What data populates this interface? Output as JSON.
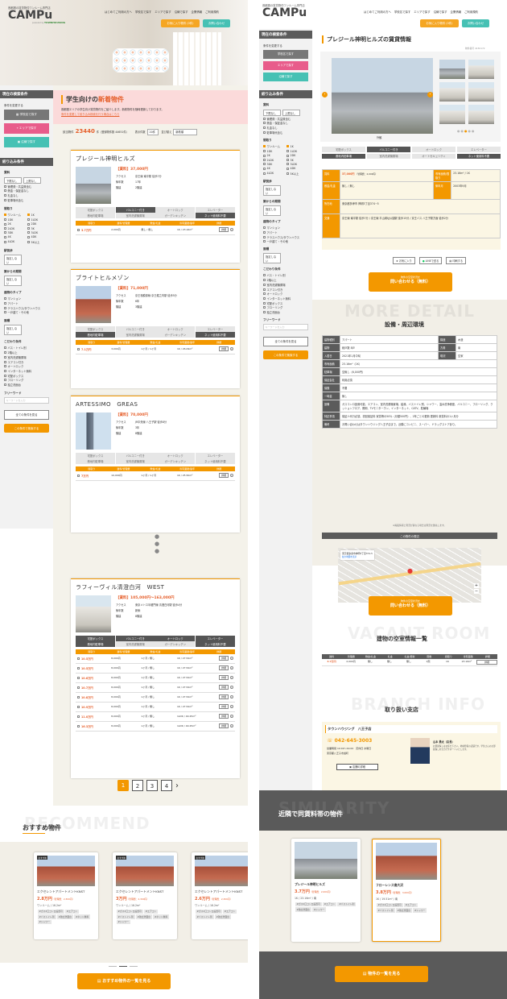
{
  "left": {
    "header": {
      "tagline": "首都圏の賃貸物件ワンルーム専門店",
      "logo": "CAMPu",
      "logo_sub": "powered by",
      "partner": "TOWNHOUSING",
      "nav": [
        "はじめてご利用の方へ",
        "学校名で探す",
        "エリアで探す",
        "沿線で探す",
        "企業情報",
        "ご利用規約"
      ],
      "btn_inquiry": "お気に入り物件 (0件)",
      "btn_contact": "お問い合わせ"
    },
    "sidebar": {
      "current_title": "現在の検索条件",
      "change_label": "条件を変更する",
      "btn_school": "学校名で探す",
      "btn_area": "エリアで探す",
      "btn_line": "沿線で探す",
      "refine_title": "絞り込み条件",
      "rent_label": "賃料",
      "rent_min": "下限なし",
      "rent_max": "上限なし",
      "rent_opts": [
        "管理費・共益費含む",
        "敷金・保証金なし",
        "礼金なし",
        "駐車場代含む"
      ],
      "layout_label": "間取り",
      "layouts": [
        "ワンルーム",
        "1K",
        "1DK",
        "1LDK",
        "2K",
        "2DK",
        "2LDK",
        "3K",
        "3DK",
        "3LDK",
        "4K",
        "4DK",
        "4LDK",
        "5K以上"
      ],
      "walk_label": "駅徒歩",
      "walk_val": "指定しない",
      "age_label": "築からの期間",
      "age_val": "指定しない",
      "type_label": "建物のタイプ",
      "types": [
        "マンション",
        "アパート",
        "テラスハウス/タウンハウス",
        "一戸建て・その他"
      ],
      "area_label": "面積",
      "area_val": "指定しない",
      "feature_label": "こだわり条件",
      "features": [
        "バス・トイレ別",
        "2階以上",
        "室内洗濯機置場",
        "エアコン付き",
        "オートロック",
        "インターネット無料",
        "宅配ボックス",
        "フローリング",
        "独立洗面台"
      ],
      "free_label": "フリーワード",
      "free_ph": "キーワードを入力",
      "btn_all": "全ての条件を見る",
      "btn_search": "この条件で検索する"
    },
    "banner": {
      "title_a": "学生向けの",
      "title_b": "新着物件",
      "desc": "首都圏エリアの学生向け賃貸物件をご紹介します。新着物件を随時更新しております。",
      "link": "条件を変更して絞り込み検索を行う場合はこちら"
    },
    "count": {
      "label": "該当物件",
      "num": "23440",
      "unit": "件（登録物件数 44651件）",
      "per_label": "表示件数",
      "per_val": "20件",
      "sort_label": "並び替え",
      "sort_val": "新着順"
    },
    "table_head": [
      "間取り",
      "賃料/管理費",
      "敷金/礼金",
      "専有面積/築年",
      "詳細"
    ],
    "listings": [
      {
        "name": "プレジール神明ヒルズ",
        "price": "【賃料】37,000円",
        "access_label": "アクセス",
        "access": "京王線 南平駅 徒歩7分",
        "age_label": "築年数",
        "age": "17年",
        "floors_label": "階建",
        "floors": "2階建",
        "rows": [
          {
            "rent": "3.7万円",
            "fee": "2,000円",
            "dep": "無し / 無し",
            "lay": "1K / 23.16m²",
            "btn": "詳細"
          }
        ]
      },
      {
        "name": "ブライトヒルメゾン",
        "price": "【賃料】71,000円",
        "access_label": "アクセス",
        "access": "京王相模原線 京王堀之内駅 徒歩5分",
        "age_label": "築年数",
        "age": "6年",
        "floors_label": "階建",
        "floors": "3階建",
        "rows": [
          {
            "rent": "7.1万円",
            "fee": "3,000円",
            "dep": "1ヶ月 / 1ヶ月",
            "lay": "1K / 26.09m²",
            "btn": "詳細"
          }
        ]
      },
      {
        "name": "ARTESSIMO　GREAS",
        "price": "【賃料】70,000円",
        "access_label": "アクセス",
        "access": "JR中央線 八王子駅 徒歩8分",
        "age_label": "築年数",
        "age": "3年",
        "floors_label": "階建",
        "floors": "8階建",
        "rows": [
          {
            "rent": "7万円",
            "fee": "10,000円",
            "dep": "1ヶ月 / 1ヶ月",
            "lay": "1K / 25.50m²",
            "btn": "詳細"
          }
        ]
      },
      {
        "name": "ラフィーヴィル清澄白河　WEST",
        "price": "【賃料】105,000円〜163,000円",
        "access_label": "アクセス",
        "access": "東京メトロ半蔵門線 清澄白河駅 徒歩4分",
        "age_label": "築年数",
        "age": "新築",
        "floors_label": "階建",
        "floors": "8階建",
        "rows": [
          {
            "rent": "10.5万円",
            "fee": "8,000円",
            "dep": "1ヶ月 / 無し",
            "lay": "1K / 27.52m²",
            "btn": "詳細"
          },
          {
            "rent": "10.5万円",
            "fee": "8,000円",
            "dep": "1ヶ月 / 無し",
            "lay": "1K / 27.52m²",
            "btn": "詳細"
          },
          {
            "rent": "10.6万円",
            "fee": "8,000円",
            "dep": "1ヶ月 / 無し",
            "lay": "1K / 27.52m²",
            "btn": "詳細"
          },
          {
            "rent": "10.7万円",
            "fee": "8,000円",
            "dep": "1ヶ月 / 無し",
            "lay": "1K / 27.52m²",
            "btn": "詳細"
          },
          {
            "rent": "10.8万円",
            "fee": "8,000円",
            "dep": "1ヶ月 / 無し",
            "lay": "1K / 27.52m²",
            "btn": "詳細"
          },
          {
            "rent": "10.9万円",
            "fee": "8,000円",
            "dep": "1ヶ月 / 無し",
            "lay": "1K / 27.52m²",
            "btn": "詳細"
          },
          {
            "rent": "11.0万円",
            "fee": "8,000円",
            "dep": "1ヶ月 / 無し",
            "lay": "1LDK / 40.25m²",
            "btn": "詳細"
          },
          {
            "rent": "16.3万円",
            "fee": "8,000円",
            "dep": "1ヶ月 / 無し",
            "lay": "1LDK / 40.25m²",
            "btn": "詳細"
          }
        ]
      }
    ],
    "features": [
      "宅配ボックス",
      "バルコニー付き",
      "オートロック",
      "エレベーター",
      "敷地内駐車場",
      "室内洗濯機置場",
      "ガーデンキッチン",
      "ネット使用料不要"
    ],
    "pages": [
      "1",
      "2",
      "3",
      "4"
    ],
    "rec_title": "おすすめ物件",
    "rec_bg": "RECOMMEND",
    "rec": [
      {
        "badge": "おすすめ",
        "name": "エクセレントアパートメントKNST",
        "price": "2.8万円",
        "fee": "（管理費：2,300円）",
        "spec": "ワンルーム / 16.2m²",
        "tags": [
          "#ガス2口コンロ設置可",
          "#エアコン",
          "#バストイレ別",
          "#独立洗面台",
          "#ネット無料",
          "#シャワー"
        ]
      },
      {
        "badge": "おすすめ",
        "name": "エクセレントアパートメントKNST",
        "price": "3万円",
        "fee": "（管理費：2,300円）",
        "spec": "ワンルーム / 16.2m²",
        "tags": [
          "#ガス2口コンロ設置可",
          "#エアコン",
          "#バストイレ別",
          "#独立洗面台",
          "#ネット無料",
          "#シャワー"
        ]
      },
      {
        "badge": "おすすめ",
        "name": "エクセレントアパートメントKNST",
        "price": "2.6万円",
        "fee": "（管理費：2,300円）",
        "spec": "ワンルーム / 16.2m²",
        "tags": [
          "#ガス2口コンロ設置可",
          "#エアコン",
          "#バストイレ別",
          "#独立洗面台"
        ]
      }
    ],
    "rec_btn": "おすすめ物件の一覧を見る"
  },
  "right": {
    "title": "プレジール神明ヒルズの賃貸情報",
    "update": "物件番号 4150172",
    "caption": "外観",
    "features": [
      "宅配ボックス",
      "バルコニー付き",
      "オートロック",
      "エレベーター",
      "敷地内駐車場",
      "室内洗濯機置場",
      "オートセキュリティ",
      "ネット使用料不要"
    ],
    "summary": [
      {
        "k": "賃料",
        "v": "37,000円",
        "sub": "（管理費：2,000円）",
        "k2": "専有面積/間取り",
        "v2": "23.16m² / 1K"
      },
      {
        "k": "敷金/礼金",
        "v": "無し / 無し",
        "k2": "築年月",
        "v2": "2003年9月"
      },
      {
        "k": "所在地",
        "v": "東京都多摩市 神明3丁目374−5"
      },
      {
        "k": "交通",
        "v": "京王線 南平駅 徒歩7分 / 京王線 平山城址公園駅 徒歩15分 / 京王バス 八王子駅方面 徒歩2分"
      }
    ],
    "share": [
      "お気に入り",
      "LINEで送る",
      "印刷する"
    ],
    "contact_sub": "物件の空室状況を",
    "contact": "問い合わせる（無料）",
    "facility_bg": "MORE DETAIL",
    "facility_title": "設備・周辺環境",
    "details": [
      [
        "建物種別",
        "アパート",
        "構造",
        "木造"
      ],
      [
        "建物",
        "総戸数 8戸",
        "方角",
        "南"
      ],
      [
        "入居日",
        "2021年1月中旬",
        "現況",
        "空家"
      ],
      [
        "専有面積",
        "23.16m²（1K）"
      ],
      [
        "駐車場",
        "空無し（6,000円）"
      ],
      [
        "保証会社",
        "利用必須"
      ],
      [
        "保険",
        "不要"
      ],
      [
        "一時金",
        "無し"
      ],
      [
        "設備",
        "ガスコンロ設置可能、エアコン、室内洗濯機置場、給湯、バストイレ別、シャワー、温水洗浄便座、バルコニー、フローリング、クッションフロア、照明、TVモニターホン、インターネット、CATV、駐輪場"
      ],
      [
        "特記事項",
        "保証人代行必須、初回保証料 家賃等の50％（月額500円）、2年ごとの更新 更新料 新賃料の1ヶ月分"
      ],
      [
        "備考",
        "お問い合わせはタウンハウジング八王子店まで。近隣にコンビニ、スーパー、ドラッグストアあり。"
      ]
    ],
    "note": "※掲載情報と現況が異なる場合は現況を優先します。",
    "map_title": "この物件の周辺",
    "map_label": "東京都多摩市神明3丁目374-5",
    "map_link": "拡大地図を表示",
    "vacant_bg": "VACANT ROOM",
    "vacant_title": "建物の空室情報一覧",
    "vacant_head": [
      "賃料",
      "管理費",
      "敷金/礼金",
      "礼金",
      "礼金/更新",
      "階数",
      "間取り",
      "専有面積",
      "詳細"
    ],
    "vacant_row": [
      "3.7万円",
      "2,000円",
      "無し",
      "無し",
      "無し",
      "1階",
      "1K",
      "23.16m²",
      "詳細"
    ],
    "branch_bg": "BRANCH INFO",
    "branch_title": "取り扱い支店",
    "branch_name": "タウンハウジング　八王子店",
    "branch_tel": "042-645-3003",
    "branch_hours": "営業時間 10:00〜19:00　定休日 水曜日",
    "branch_addr": "東京都八王子市旭町",
    "branch_btn": "店舗の詳細",
    "staff_name": "山本 勇太（店長）",
    "staff_msg": "お部屋探しはお任せ下さい。地域密着の店舗です。学生さんのお部屋探しを全力でサポートいたします。",
    "sim_bg": "SIMILARITY",
    "sim_title": "近隣で同賃料帯の物件",
    "sim": [
      {
        "name": "プレジール神明ヒルズ",
        "price": "3.7万円",
        "fee": "（管理費：2,000円）",
        "spec": "1K / 23.16m² / 南",
        "tags": [
          "#ガス2口コンロ設置可",
          "#エアコン",
          "#バストイレ別",
          "#独立洗面台",
          "#シャワー"
        ]
      },
      {
        "name": "フローレンス南大沢",
        "price": "3.8万円",
        "fee": "（管理費：3,000円）",
        "spec": "1K / 19.51m² / 南",
        "tags": [
          "#ガス2口コンロ設置可",
          "#エアコン",
          "#バストイレ別",
          "#独立洗面台",
          "#シャワー"
        ]
      }
    ],
    "sim_btn": "物件の一覧を見る"
  },
  "colors": {
    "accent": "#f39800",
    "red": "#e6612e",
    "pink": "#fbdada",
    "gray": "#5b5b5b",
    "teal": "#46c1b4"
  }
}
